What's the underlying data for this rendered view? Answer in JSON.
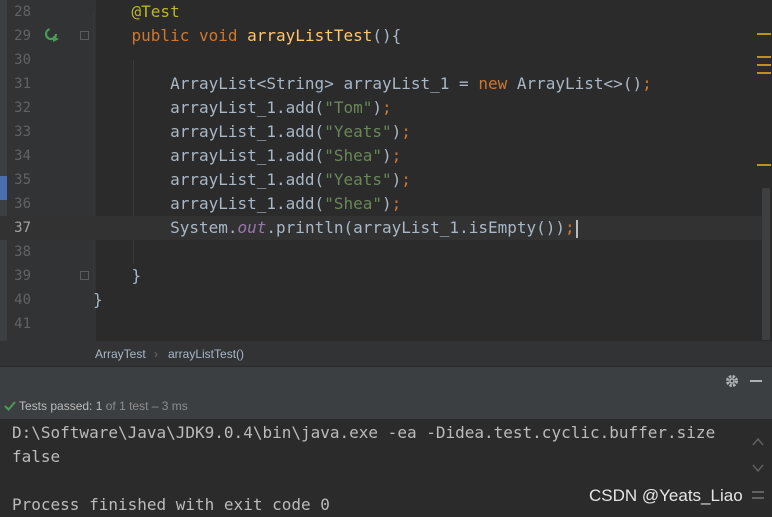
{
  "editor": {
    "lines": [
      {
        "num": "28",
        "tokens": [
          {
            "t": "    "
          },
          {
            "t": "@Test",
            "c": "ann"
          }
        ]
      },
      {
        "num": "29",
        "tokens": [
          {
            "t": "    "
          },
          {
            "t": "public",
            "c": "kw"
          },
          {
            "t": " "
          },
          {
            "t": "void",
            "c": "kw"
          },
          {
            "t": " "
          },
          {
            "t": "arrayListTest",
            "c": "fn"
          },
          {
            "t": "(){"
          }
        ]
      },
      {
        "num": "30",
        "tokens": []
      },
      {
        "num": "31",
        "tokens": [
          {
            "t": "        ArrayList<String> arrayList_1 = "
          },
          {
            "t": "new",
            "c": "kw"
          },
          {
            "t": " ArrayList<>()"
          },
          {
            "t": ";",
            "c": "kw"
          }
        ]
      },
      {
        "num": "32",
        "tokens": [
          {
            "t": "        arrayList_1.add("
          },
          {
            "t": "\"Tom\"",
            "c": "str"
          },
          {
            "t": ")"
          },
          {
            "t": ";",
            "c": "kw"
          }
        ]
      },
      {
        "num": "33",
        "tokens": [
          {
            "t": "        arrayList_1.add("
          },
          {
            "t": "\"Yeats\"",
            "c": "str"
          },
          {
            "t": ")"
          },
          {
            "t": ";",
            "c": "kw"
          }
        ]
      },
      {
        "num": "34",
        "tokens": [
          {
            "t": "        arrayList_1.add("
          },
          {
            "t": "\"Shea\"",
            "c": "str"
          },
          {
            "t": ")"
          },
          {
            "t": ";",
            "c": "kw"
          }
        ]
      },
      {
        "num": "35",
        "tokens": [
          {
            "t": "        arrayList_1.add("
          },
          {
            "t": "\"Yeats\"",
            "c": "str"
          },
          {
            "t": ")"
          },
          {
            "t": ";",
            "c": "kw"
          }
        ]
      },
      {
        "num": "36",
        "tokens": [
          {
            "t": "        arrayList_1.add("
          },
          {
            "t": "\"Shea\"",
            "c": "str"
          },
          {
            "t": ")"
          },
          {
            "t": ";",
            "c": "kw"
          }
        ]
      },
      {
        "num": "37",
        "current": true,
        "tokens": [
          {
            "t": "        System."
          },
          {
            "t": "out",
            "c": "fld"
          },
          {
            "t": ".println(arrayList_1.isEmpty())"
          },
          {
            "t": ";",
            "c": "kw"
          }
        ]
      },
      {
        "num": "38",
        "tokens": []
      },
      {
        "num": "39",
        "tokens": [
          {
            "t": "    }"
          }
        ]
      },
      {
        "num": "40",
        "tokens": [
          {
            "t": "}"
          }
        ]
      },
      {
        "num": "41",
        "tokens": []
      }
    ]
  },
  "breadcrumb": {
    "class_name": "ArrayTest",
    "separator": "›",
    "method_name": "arrayListTest()"
  },
  "status": {
    "passed_label": "Tests passed:",
    "count_text": "1",
    "rest_text": "of 1 test – 3 ms"
  },
  "console": {
    "command": "D:\\Software\\Java\\JDK9.0.4\\bin\\java.exe -ea -Didea.test.cyclic.buffer.size",
    "output": "false",
    "exit_message": "Process finished with exit code 0"
  },
  "watermark": "CSDN @Yeats_Liao",
  "colors": {
    "keyword": "#cc7832",
    "string": "#6a8759",
    "annotation": "#bbb529",
    "method": "#ffc66d",
    "field": "#9876aa",
    "success": "#499c54"
  }
}
